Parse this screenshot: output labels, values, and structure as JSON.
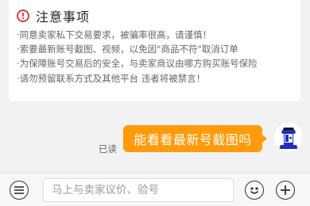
{
  "notice": {
    "title": "注意事项",
    "lines": [
      "·同意卖家私下交易要求，被骗率很高，请谨慎！",
      "·索要最新账号截图、视频，以免因\"商品不符\"取消订单",
      "·为保障账号交易后的安全，与卖家商议由哪方购买账号保险",
      "·请勿预留联系方式及其他平台 违者将被禁言！"
    ]
  },
  "message": {
    "status": "已读",
    "text": "能看看最新号截图吗"
  },
  "input": {
    "placeholder": "马上与卖家议价、验号"
  },
  "colors": {
    "bubble": "#ff9a0a",
    "warning": "#e53935"
  },
  "icons": {
    "left": "menu-lines-icon",
    "emoji": "smiley-icon",
    "add": "plus-icon",
    "warning": "exclamation-circle-icon"
  }
}
